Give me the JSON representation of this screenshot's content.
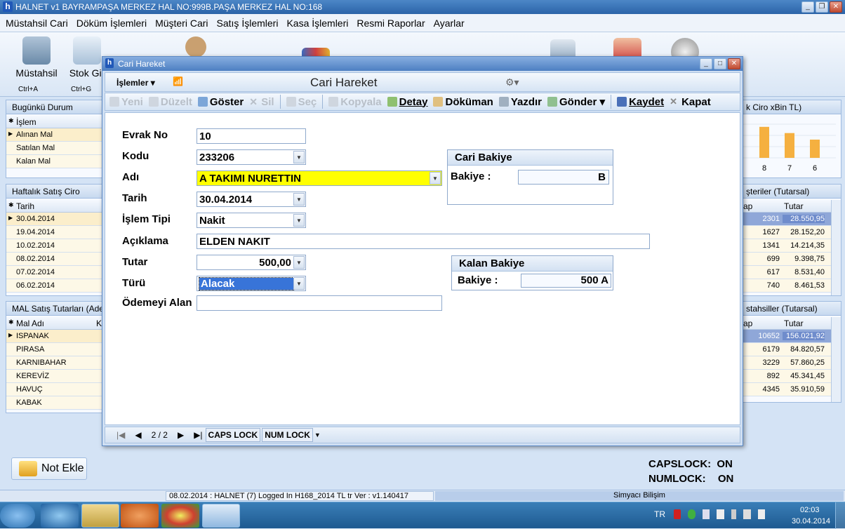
{
  "app": {
    "title": "HALNET v1 BAYRAMPAŞA MERKEZ HAL NO:999B.PAŞA MERKEZ HAL NO:168",
    "window_buttons": {
      "minimize": "_",
      "restore": "❐",
      "close": "✕"
    }
  },
  "menu": [
    "Müstahsil Cari",
    "Döküm İşlemleri",
    "Müşteri Cari",
    "Satış İşlemleri",
    "Kasa İşlemleri",
    "Resmi Raporlar",
    "Ayarlar"
  ],
  "ribbon": {
    "items": [
      {
        "label": "Müstahsil",
        "icon": "truck-icon",
        "shortcut": "Ctrl+A"
      },
      {
        "label": "Stok Gir",
        "icon": "clipboard-icon",
        "shortcut": "Ctrl+G"
      }
    ]
  },
  "left_panels": {
    "bugun": {
      "title": "Bugünkü Durum",
      "header": "İşlem",
      "rows": [
        "Alınan Mal",
        "Satılan Mal",
        "Kalan Mal"
      ]
    },
    "haftalik": {
      "title": "Haftalık Satış Ciro",
      "header": "Tarih",
      "rows": [
        "30.04.2014",
        "19.04.2014",
        "10.02.2014",
        "08.02.2014",
        "07.02.2014",
        "06.02.2014"
      ]
    },
    "mal": {
      "title": "MAL Satış Tutarları (Adet",
      "header": "Mal Adı",
      "header2": "K",
      "rows": [
        "ISPANAK",
        "PIRASA",
        "KARNIBAHAR",
        "KEREVİZ",
        "HAVUÇ",
        "KABAK"
      ]
    }
  },
  "right_panels": {
    "ciro": {
      "title": "k Ciro xBin TL)",
      "bar_labels": [
        "8",
        "7",
        "6"
      ],
      "bar_values": [
        0.85,
        0.68,
        0.5
      ],
      "bar_color": "#f5b040"
    },
    "musteriler": {
      "title": "şteriler (Tutarsal)",
      "col1": "ap",
      "col2": "Tutar",
      "rows": [
        [
          "2301",
          "28.550,95"
        ],
        [
          "1627",
          "28.152,20"
        ],
        [
          "1341",
          "14.214,35"
        ],
        [
          "699",
          "9.398,75"
        ],
        [
          "617",
          "8.531,40"
        ],
        [
          "740",
          "8.461,53"
        ]
      ]
    },
    "mustahsiller": {
      "title": "stahsiller (Tutarsal)",
      "col1": "ap",
      "col2": "Tutar",
      "rows": [
        [
          "10652",
          "156.021,92"
        ],
        [
          "6179",
          "84.820,57"
        ],
        [
          "3229",
          "57.860,25"
        ],
        [
          "892",
          "45.341,45"
        ],
        [
          "4345",
          "35.910,59"
        ]
      ]
    }
  },
  "dialog": {
    "title": "Cari Hareket",
    "heading": "Cari Hareket",
    "islemler": "İşlemler",
    "toolbar": [
      {
        "label": "Yeni",
        "enabled": false,
        "name": "new-button"
      },
      {
        "label": "Düzelt",
        "enabled": false,
        "name": "edit-button"
      },
      {
        "label": "Göster",
        "enabled": true,
        "name": "show-button"
      },
      {
        "label": "Sil",
        "enabled": false,
        "name": "delete-button"
      },
      {
        "label": "Seç",
        "enabled": false,
        "name": "select-button"
      },
      {
        "label": "Kopyala",
        "enabled": false,
        "name": "copy-button"
      },
      {
        "label": "Detay",
        "enabled": true,
        "name": "detail-button"
      },
      {
        "label": "Döküman",
        "enabled": true,
        "name": "document-button"
      },
      {
        "label": "Yazdır",
        "enabled": true,
        "name": "print-button"
      },
      {
        "label": "Gönder",
        "enabled": true,
        "name": "send-button"
      },
      {
        "label": "Kaydet",
        "enabled": true,
        "name": "save-button"
      },
      {
        "label": "Kapat",
        "enabled": true,
        "name": "close-dialog-button"
      }
    ],
    "form": {
      "evrak_no": {
        "label": "Evrak No",
        "value": "10"
      },
      "kodu": {
        "label": "Kodu",
        "value": "233206"
      },
      "adi": {
        "label": "Adı",
        "value": "A TAKIMI NURETTIN"
      },
      "tarih": {
        "label": "Tarih",
        "value": "30.04.2014"
      },
      "islem_tipi": {
        "label": "İşlem Tipi",
        "value": "Nakit"
      },
      "aciklama": {
        "label": "Açıklama",
        "value": "ELDEN NAKIT"
      },
      "tutar": {
        "label": "Tutar",
        "value": "500,00"
      },
      "turu": {
        "label": "Türü",
        "value": "Alacak"
      },
      "odemeyi_alan": {
        "label": "Ödemeyi Alan",
        "value": ""
      }
    },
    "cari_bakiye": {
      "title": "Cari Bakiye",
      "label": "Bakiye :",
      "value": "B"
    },
    "kalan_bakiye": {
      "title": "Kalan Bakiye",
      "label": "Bakiye :",
      "value": "500 A"
    },
    "status": {
      "page": "2 / 2",
      "caps": "CAPS LOCK",
      "num": "NUM LOCK"
    }
  },
  "bottom": {
    "not_ekle": "Not Ekle",
    "capslock_label": "CAPSLOCK:",
    "capslock_value": "ON",
    "numlock_label": "NUMLOCK:",
    "numlock_value": "ON",
    "status_left": "08.02.2014 : HALNET (7) Logged In H168_2014 TL tr Ver : v1.140417",
    "status_right": "Simyacı Bilişim"
  },
  "taskbar": {
    "lang": "TR",
    "time": "02:03",
    "date": "30.04.2014"
  }
}
